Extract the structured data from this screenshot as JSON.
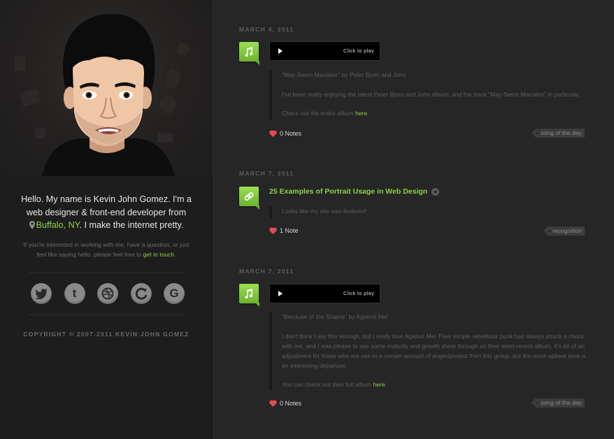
{
  "sidebar": {
    "intro_line1": "Hello. My name is Kevin John Gomez. I'm a",
    "intro_line2": "web designer & front-end developer from",
    "location": "Buffalo, NY",
    "intro_line3_rest": ". I make the internet pretty.",
    "contact_text": "If you're interested in working with me, have a question, or just feel like saying hello, please feel free to",
    "contact_link": "get in touch",
    "contact_end": ".",
    "socials": [
      {
        "name": "twitter-icon",
        "glyph": "t"
      },
      {
        "name": "tumblr-icon",
        "glyph": "t"
      },
      {
        "name": "dribbble-icon",
        "glyph": "◎"
      },
      {
        "name": "forrst-icon",
        "glyph": "C"
      },
      {
        "name": "github-icon",
        "glyph": "G"
      }
    ],
    "copyright": "COPYRIGHT © 2007-2011 KEVIN JOHN GOMEZ"
  },
  "colors": {
    "accent": "#8ed04a",
    "heart": "#e8475a"
  },
  "posts": [
    {
      "date": "MARCH 4, 2011",
      "type": "audio",
      "icon": "music-note-icon",
      "play_label": "Click to play",
      "quote_title": "\"May Seem Macabre\" by Peter Bjorn and John",
      "body": "I've been really enjoying the latest Peter Bjorn and John album, and the track \"May Seem Macabre\" in particular.",
      "cta_text": "Check out the entire album",
      "cta_link": "here",
      "cta_end": ".",
      "notes": "0 Notes",
      "tag": "song of the day"
    },
    {
      "date": "MARCH 7, 2011",
      "type": "link",
      "icon": "link-icon",
      "title": "25 Examples of Portrait Usage in Web Design",
      "body": "Looks like my site was featured!",
      "notes": "1 Note",
      "tag": "recognition"
    },
    {
      "date": "MARCH 7, 2011",
      "type": "audio",
      "icon": "music-note-icon",
      "play_label": "Click to play",
      "quote_title": "\"Because of the Shame\" by Against Me!",
      "body": "I don't think I say this enough, but I really love Against Me! Their simple rebellious punk has always struck a chord with me, and I was please to see some maturity and growth shine through on their most recent album. It's bit of an adjustment for those who are use to a certain amount of anger/protest from this group, but the more upbeat tone is an interesting departure.",
      "cta_text": "You can check out their full album",
      "cta_link": "here",
      "cta_end": ".",
      "notes": "0 Notes",
      "tag": "song of the day"
    }
  ]
}
